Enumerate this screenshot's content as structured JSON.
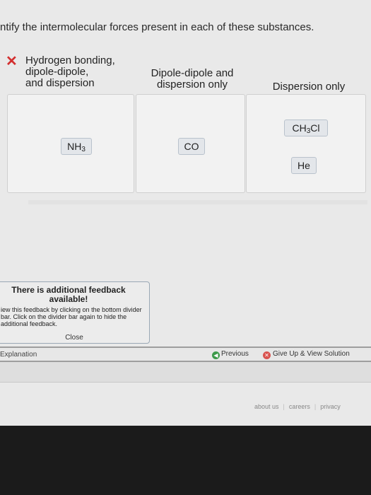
{
  "question": "ntify the intermolecular forces present in each of these substances.",
  "bins": [
    {
      "label": "Hydrogen bonding,\ndipole-dipole,\nand dispersion",
      "status": "incorrect"
    },
    {
      "label": "Dipole-dipole and\ndispersion only"
    },
    {
      "label": "Dispersion only"
    }
  ],
  "tiles": {
    "nh3": {
      "main": "NH",
      "sub": "3"
    },
    "co": {
      "main": "CO"
    },
    "ch3cl": {
      "pre": "CH",
      "sub": "3",
      "post": "Cl"
    },
    "he": {
      "main": "He"
    }
  },
  "feedback": {
    "title": "There is additional feedback available!",
    "body": "iew this feedback by clicking on the bottom divider bar. Click on the divider bar again to hide the additional feedback.",
    "close": "Close"
  },
  "divider": {
    "explanation": "Explanation",
    "previous": "Previous",
    "give_up": "Give Up & View Solution"
  },
  "footer": {
    "about": "about us",
    "careers": "careers",
    "privacy": "privacy"
  },
  "colors": {
    "incorrect": "#d32f2f",
    "previous_icon": "#3d9a4a",
    "giveup_icon": "#d9534f"
  }
}
